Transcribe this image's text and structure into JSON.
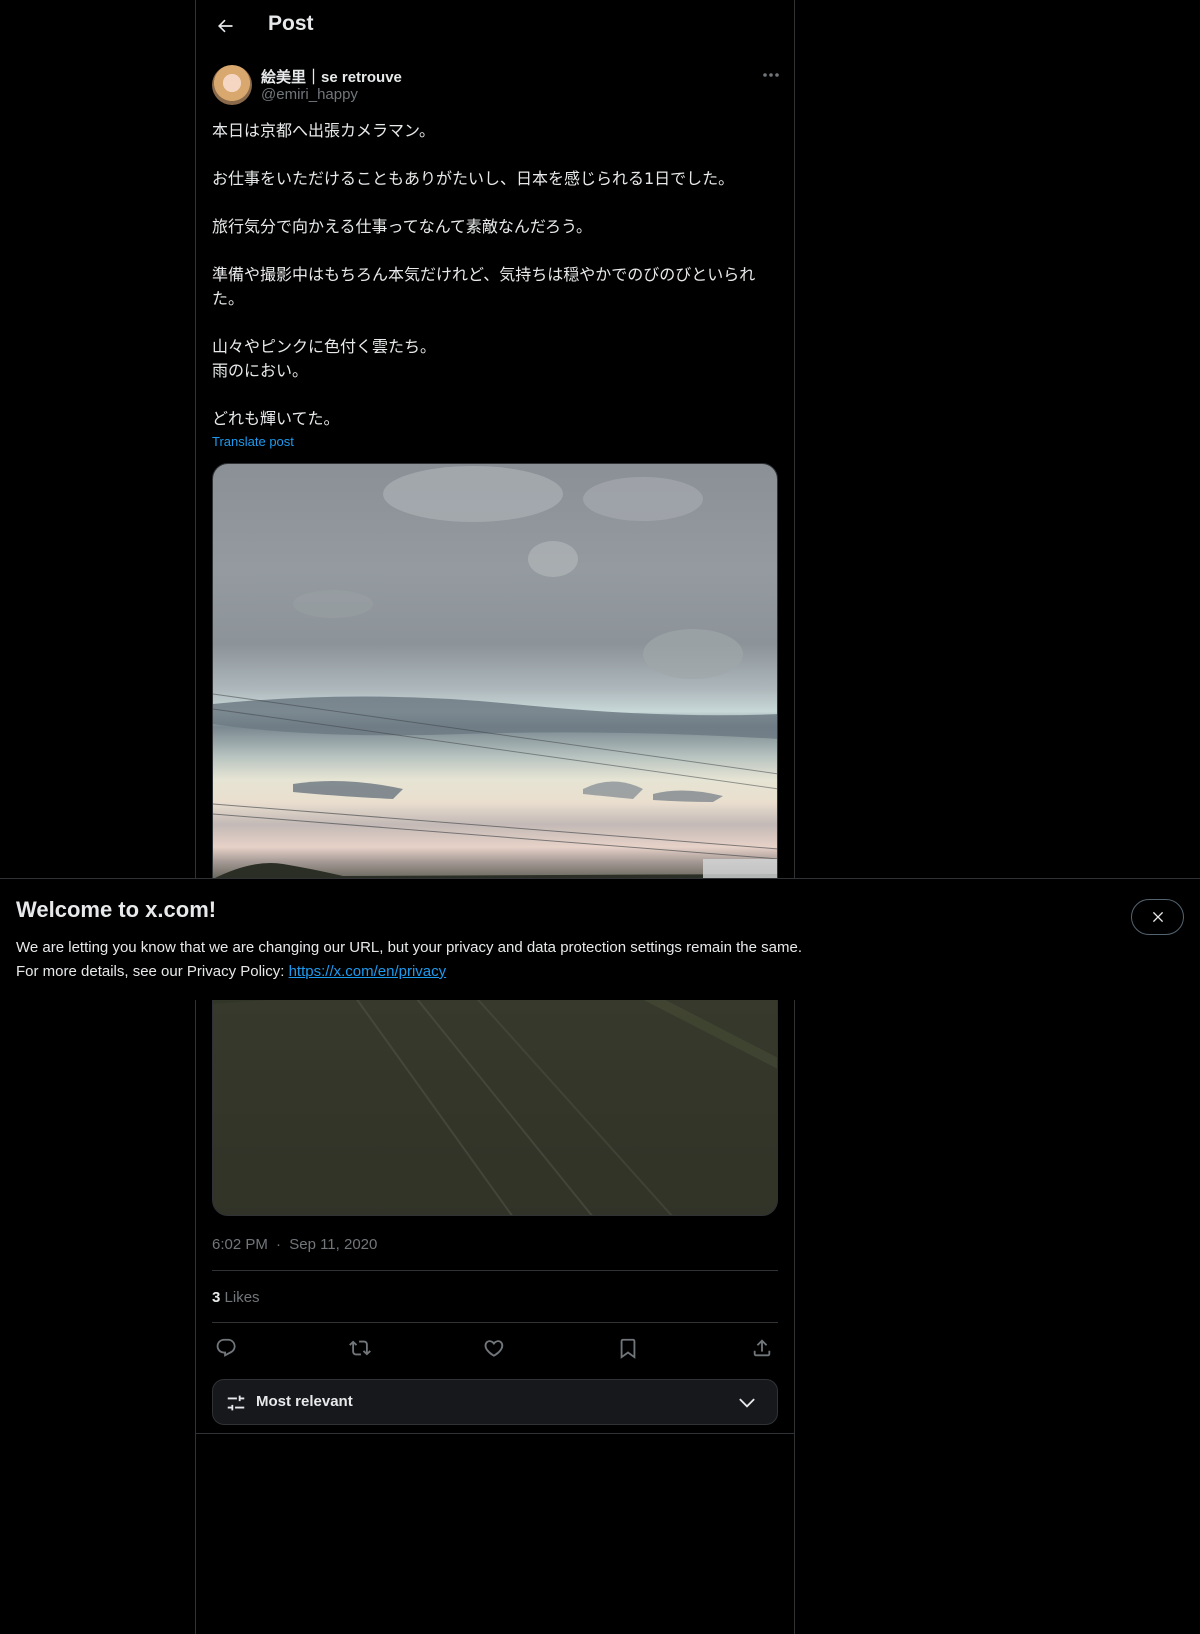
{
  "header": {
    "title": "Post"
  },
  "post": {
    "author_name": "絵美里｜se retrouve",
    "author_handle": "@emiri_happy",
    "paragraphs": [
      "本日は京都へ出張カメラマン。",
      "お仕事をいただけることもありがたいし、日本を感じられる1日でした。",
      "旅行気分で向かえる仕事ってなんて素敵なんだろう。",
      "準備や撮影中はもちろん本気だけれど、気持ちは穏やかでのびのびといられた。",
      "山々やピンクに色付く雲たち。\n雨のにおい。",
      "どれも輝いてた。"
    ],
    "translate_label": "Translate post",
    "time": "6:02 PM",
    "separator": "·",
    "date": "Sep 11, 2020",
    "likes_count": "3",
    "likes_label": "Likes"
  },
  "actions": [
    {
      "name": "reply-icon"
    },
    {
      "name": "repost-icon"
    },
    {
      "name": "like-icon"
    },
    {
      "name": "bookmark-icon"
    },
    {
      "name": "share-icon"
    }
  ],
  "sort": {
    "label": "Most relevant"
  },
  "banner": {
    "title": "Welcome to x.com!",
    "line1": "We are letting you know that we are changing our URL, but your privacy and data protection settings remain the same.",
    "line2_prefix": "For more details, see our Privacy Policy: ",
    "link_text": "https://x.com/en/privacy"
  },
  "colors": {
    "background": "#000000",
    "text": "#e7e9ea",
    "muted": "#71767b",
    "accent": "#1d9bf0",
    "border": "#2f3336"
  }
}
